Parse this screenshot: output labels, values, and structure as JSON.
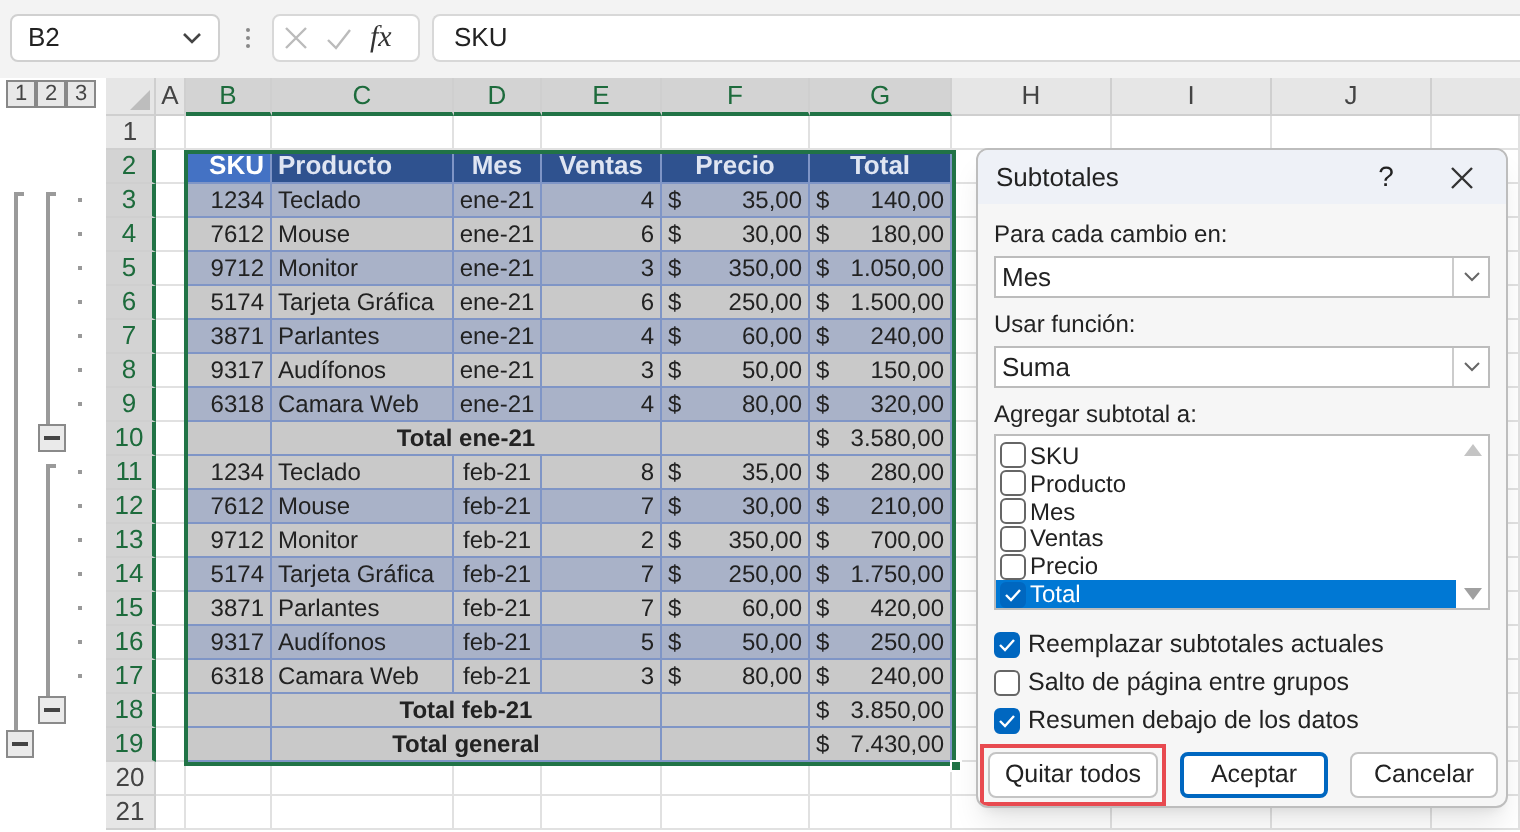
{
  "formula_bar": {
    "name_box": "B2",
    "fx": "fx",
    "formula": "SKU"
  },
  "outline_levels": [
    "1",
    "2",
    "3"
  ],
  "columns": [
    {
      "letter": "A",
      "selected": false
    },
    {
      "letter": "B",
      "selected": true
    },
    {
      "letter": "C",
      "selected": true
    },
    {
      "letter": "D",
      "selected": true
    },
    {
      "letter": "E",
      "selected": true
    },
    {
      "letter": "F",
      "selected": true
    },
    {
      "letter": "G",
      "selected": true
    },
    {
      "letter": "H",
      "selected": false
    },
    {
      "letter": "I",
      "selected": false
    },
    {
      "letter": "J",
      "selected": false
    }
  ],
  "rows": [
    {
      "number": "1",
      "selected": false,
      "kind": "empty"
    },
    {
      "number": "2",
      "selected": true,
      "kind": "header",
      "cells": [
        {
          "text": "SKU",
          "active": true
        },
        {
          "text": "Producto",
          "active": false
        },
        {
          "text": "Mes",
          "active": false
        },
        {
          "text": "Ventas",
          "active": false
        },
        {
          "text": "Precio",
          "active": false
        },
        {
          "text": "Total",
          "active": false
        }
      ]
    },
    {
      "number": "3",
      "selected": true,
      "kind": "data",
      "banded": true,
      "sku": "1234",
      "product": "Teclado",
      "month": "ene-21",
      "sales": "4",
      "price": {
        "currency": "$",
        "amount": "35,00"
      },
      "total": {
        "currency": "$",
        "amount": "140,00"
      }
    },
    {
      "number": "4",
      "selected": true,
      "kind": "data",
      "banded": false,
      "sku": "7612",
      "product": "Mouse",
      "month": "ene-21",
      "sales": "6",
      "price": {
        "currency": "$",
        "amount": "30,00"
      },
      "total": {
        "currency": "$",
        "amount": "180,00"
      }
    },
    {
      "number": "5",
      "selected": true,
      "kind": "data",
      "banded": true,
      "sku": "9712",
      "product": "Monitor",
      "month": "ene-21",
      "sales": "3",
      "price": {
        "currency": "$",
        "amount": "350,00"
      },
      "total": {
        "currency": "$",
        "amount": "1.050,00"
      }
    },
    {
      "number": "6",
      "selected": true,
      "kind": "data",
      "banded": false,
      "sku": "5174",
      "product": "Tarjeta Gráfica",
      "month": "ene-21",
      "sales": "6",
      "price": {
        "currency": "$",
        "amount": "250,00"
      },
      "total": {
        "currency": "$",
        "amount": "1.500,00"
      }
    },
    {
      "number": "7",
      "selected": true,
      "kind": "data",
      "banded": true,
      "sku": "3871",
      "product": "Parlantes",
      "month": "ene-21",
      "sales": "4",
      "price": {
        "currency": "$",
        "amount": "60,00"
      },
      "total": {
        "currency": "$",
        "amount": "240,00"
      }
    },
    {
      "number": "8",
      "selected": true,
      "kind": "data",
      "banded": false,
      "sku": "9317",
      "product": "Audífonos",
      "month": "ene-21",
      "sales": "3",
      "price": {
        "currency": "$",
        "amount": "50,00"
      },
      "total": {
        "currency": "$",
        "amount": "150,00"
      }
    },
    {
      "number": "9",
      "selected": true,
      "kind": "data",
      "banded": true,
      "sku": "6318",
      "product": "Camara Web",
      "month": "ene-21",
      "sales": "4",
      "price": {
        "currency": "$",
        "amount": "80,00"
      },
      "total": {
        "currency": "$",
        "amount": "320,00"
      }
    },
    {
      "number": "10",
      "selected": true,
      "kind": "subtotal",
      "expanded": true,
      "label": "Total ene-21",
      "total": {
        "currency": "$",
        "amount": "3.580,00"
      }
    },
    {
      "number": "11",
      "selected": true,
      "kind": "data",
      "banded": false,
      "sku": "1234",
      "product": "Teclado",
      "month": "feb-21",
      "sales": "8",
      "price": {
        "currency": "$",
        "amount": "35,00"
      },
      "total": {
        "currency": "$",
        "amount": "280,00"
      }
    },
    {
      "number": "12",
      "selected": true,
      "kind": "data",
      "banded": true,
      "sku": "7612",
      "product": "Mouse",
      "month": "feb-21",
      "sales": "7",
      "price": {
        "currency": "$",
        "amount": "30,00"
      },
      "total": {
        "currency": "$",
        "amount": "210,00"
      }
    },
    {
      "number": "13",
      "selected": true,
      "kind": "data",
      "banded": false,
      "sku": "9712",
      "product": "Monitor",
      "month": "feb-21",
      "sales": "2",
      "price": {
        "currency": "$",
        "amount": "350,00"
      },
      "total": {
        "currency": "$",
        "amount": "700,00"
      }
    },
    {
      "number": "14",
      "selected": true,
      "kind": "data",
      "banded": true,
      "sku": "5174",
      "product": "Tarjeta Gráfica",
      "month": "feb-21",
      "sales": "7",
      "price": {
        "currency": "$",
        "amount": "250,00"
      },
      "total": {
        "currency": "$",
        "amount": "1.750,00"
      }
    },
    {
      "number": "15",
      "selected": true,
      "kind": "data",
      "banded": false,
      "sku": "3871",
      "product": "Parlantes",
      "month": "feb-21",
      "sales": "7",
      "price": {
        "currency": "$",
        "amount": "60,00"
      },
      "total": {
        "currency": "$",
        "amount": "420,00"
      }
    },
    {
      "number": "16",
      "selected": true,
      "kind": "data",
      "banded": true,
      "sku": "9317",
      "product": "Audífonos",
      "month": "feb-21",
      "sales": "5",
      "price": {
        "currency": "$",
        "amount": "50,00"
      },
      "total": {
        "currency": "$",
        "amount": "250,00"
      }
    },
    {
      "number": "17",
      "selected": true,
      "kind": "data",
      "banded": false,
      "sku": "6318",
      "product": "Camara Web",
      "month": "feb-21",
      "sales": "3",
      "price": {
        "currency": "$",
        "amount": "80,00"
      },
      "total": {
        "currency": "$",
        "amount": "240,00"
      }
    },
    {
      "number": "18",
      "selected": true,
      "kind": "subtotal",
      "expanded": true,
      "label": "Total feb-21",
      "total": {
        "currency": "$",
        "amount": "3.850,00"
      }
    },
    {
      "number": "19",
      "selected": true,
      "kind": "grand_total",
      "expanded": true,
      "label": "Total general",
      "total": {
        "currency": "$",
        "amount": "7.430,00"
      }
    },
    {
      "number": "20",
      "selected": false,
      "kind": "empty"
    },
    {
      "number": "21",
      "selected": false,
      "kind": "empty"
    }
  ],
  "dialog": {
    "title": "Subtotales",
    "help": "?",
    "change_field": {
      "label": "Para cada cambio en:",
      "value": "Mes"
    },
    "function_field": {
      "label": "Usar función:",
      "value": "Suma"
    },
    "add_to": {
      "label": "Agregar subtotal a:",
      "items": [
        {
          "label": "SKU",
          "checked": false,
          "selected": false
        },
        {
          "label": "Producto",
          "checked": false,
          "selected": false
        },
        {
          "label": "Mes",
          "checked": false,
          "selected": false
        },
        {
          "label": "Ventas",
          "checked": false,
          "selected": false
        },
        {
          "label": "Precio",
          "checked": false,
          "selected": false
        },
        {
          "label": "Total",
          "checked": true,
          "selected": true
        }
      ]
    },
    "options": [
      {
        "label": "Reemplazar subtotales actuales",
        "checked": true
      },
      {
        "label": "Salto de página entre grupos",
        "checked": false
      },
      {
        "label": "Resumen debajo de los datos",
        "checked": true
      }
    ],
    "buttons": [
      {
        "label": "Quitar todos",
        "default": false,
        "highlighted": true
      },
      {
        "label": "Aceptar",
        "default": true,
        "highlighted": false
      },
      {
        "label": "Cancelar",
        "default": false,
        "highlighted": false
      }
    ]
  }
}
